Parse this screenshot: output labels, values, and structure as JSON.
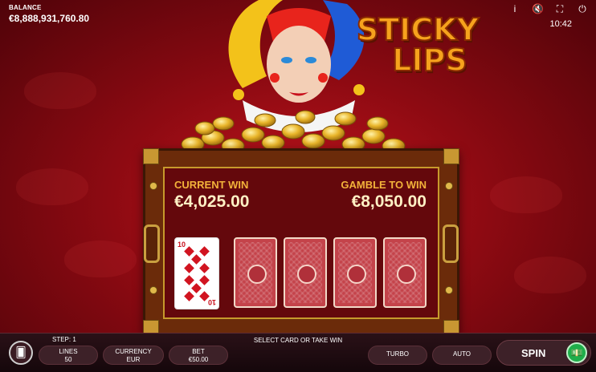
{
  "balance": {
    "label": "BALANCE",
    "value": "€8,888,931,760.80"
  },
  "top_icons": [
    "info-icon",
    "sound-off-icon",
    "fullscreen-icon",
    "power-icon"
  ],
  "top_glyphs": {
    "info": "i",
    "sound": "🔇",
    "fullscreen": "⛶",
    "power": "⏻"
  },
  "clock": "10:42",
  "logo": {
    "line1": "STICKY",
    "line2": "LIPS"
  },
  "gamble": {
    "current_win_label": "CURRENT WIN",
    "current_win_value": "€4,025.00",
    "gamble_label": "GAMBLE TO WIN",
    "gamble_value": "€8,050.00",
    "revealed_card": {
      "rank": "10",
      "suit": "diamonds"
    },
    "face_down_cards": 4
  },
  "bottom_bar": {
    "step": "STEP: 1",
    "message": "SELECT CARD OR TAKE WIN",
    "lines_label": "LINES",
    "lines_value": "50",
    "currency_label": "CURRENCY",
    "currency_value": "EUR",
    "bet_label": "BET",
    "bet_value": "€50.00",
    "turbo": "TURBO",
    "auto": "AUTO",
    "spin": "SPIN"
  },
  "colors": {
    "accent_gold": "#f2b23a",
    "spin_green": "#1fae4a",
    "background_red": "#8d0a12"
  }
}
